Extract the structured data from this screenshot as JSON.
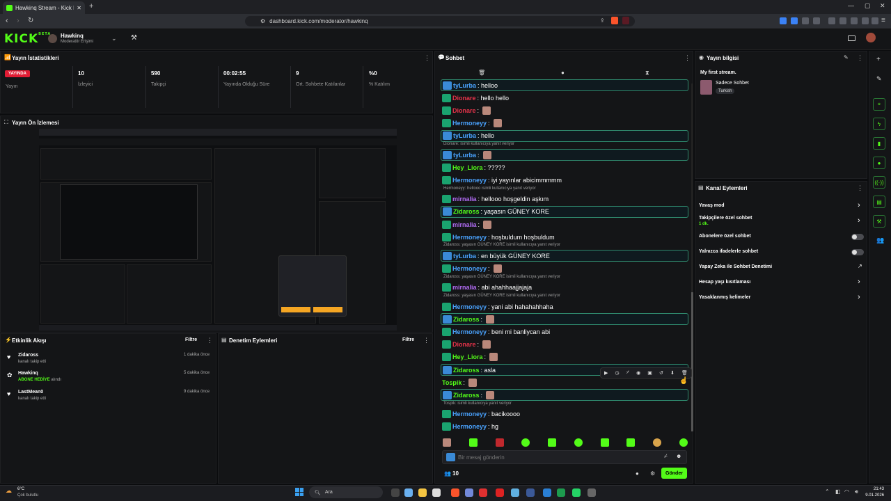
{
  "browser": {
    "tab_title": "Hawkinq Stream - Kick Dashb",
    "url": "dashboard.kick.com/moderator/hawkinq"
  },
  "header": {
    "logo": "KICK",
    "logo_tag": "BETA",
    "channel_name": "Hawkinq",
    "role": "Moderatör Erişimi"
  },
  "stats": {
    "title": "Yayın İstatistikleri",
    "live_badge": "YAYINDA",
    "live_label": "Yayın",
    "items": [
      {
        "value": "10",
        "label": "İzleyici"
      },
      {
        "value": "590",
        "label": "Takipçi"
      },
      {
        "value": "00:02:55",
        "label": "Yayında Olduğu Süre"
      },
      {
        "value": "9",
        "label": "Ort. Sohbete Katılanlar"
      },
      {
        "value": "%0",
        "label": "% Katılım"
      }
    ]
  },
  "preview": {
    "title": "Yayın Ön İzlemesi"
  },
  "activity": {
    "title": "Etkinlik Akışı",
    "filter": "Filtre",
    "items": [
      {
        "name": "Zidaross",
        "desc": "kanalı takip etti",
        "highlight": "",
        "time": "1 dakika önce"
      },
      {
        "name": "Hawkinq",
        "desc": "alındı",
        "highlight": "ABONE HEDİYE",
        "time": "5 dakika önce"
      },
      {
        "name": "LastMean0",
        "desc": "kanalı takip etti",
        "highlight": "",
        "time": "9 dakika önce"
      }
    ]
  },
  "moderation": {
    "title": "Denetim Eylemleri",
    "filter": "Filtre"
  },
  "chat": {
    "title": "Sohbet",
    "input_placeholder": "Bir mesaj gönderin",
    "viewer_count": "10",
    "send": "Gönder",
    "messages": [
      {
        "user": "tyLurba",
        "color": "#4aa3ff",
        "text": ": helloo",
        "hl": true,
        "badge": "b-blu",
        "emote": false,
        "reply": ""
      },
      {
        "user": "Dionare",
        "color": "#e8334a",
        "text": ": hello hello",
        "hl": false,
        "badge": "b-grn",
        "emote": false,
        "reply": ""
      },
      {
        "user": "Dionare",
        "color": "#e8334a",
        "text": ":",
        "hl": false,
        "badge": "b-grn",
        "emote": true,
        "reply": ""
      },
      {
        "user": "Hermoneyy",
        "color": "#4aa3ff",
        "text": ":",
        "hl": false,
        "badge": "b-grn",
        "emote": true,
        "reply": ""
      },
      {
        "user": "tyLurba",
        "color": "#4aa3ff",
        "text": ": hello",
        "hl": true,
        "badge": "b-blu",
        "emote": false,
        "reply": ""
      },
      {
        "user": "tyLurba",
        "color": "#4aa3ff",
        "text": ":",
        "hl": true,
        "badge": "b-blu",
        "emote": true,
        "reply": "Dionare: isimli kullanıcıya yanıt veriyor"
      },
      {
        "user": "Hey_Liora",
        "color": "#53fc18",
        "text": ": ?????",
        "hl": false,
        "badge": "b-grn",
        "emote": false,
        "reply": ""
      },
      {
        "user": "Hermoneyy",
        "color": "#4aa3ff",
        "text": ": iyi yayınlar abicimmmmm",
        "hl": false,
        "badge": "b-grn",
        "emote": false,
        "reply": ""
      },
      {
        "user": "mirnalia",
        "color": "#b26cf5",
        "text": ": hellooo hoşgeldin aşkım",
        "hl": false,
        "badge": "b-grn",
        "emote": false,
        "reply": "Hermoneyy: hellooo isimli kullanıcıya yanıt veriyor"
      },
      {
        "user": "Zidaross",
        "color": "#53fc18",
        "text": ": yaşasın GÜNEY KORE",
        "hl": true,
        "badge": "b-blu",
        "emote": false,
        "reply": ""
      },
      {
        "user": "mirnalia",
        "color": "#b26cf5",
        "text": ":",
        "hl": false,
        "badge": "b-grn",
        "emote": true,
        "reply": ""
      },
      {
        "user": "Hermoneyy",
        "color": "#4aa3ff",
        "text": ": hoşbuldum hoşbuldum",
        "hl": false,
        "badge": "b-grn",
        "emote": false,
        "reply": ""
      },
      {
        "user": "tyLurba",
        "color": "#4aa3ff",
        "text": ": en büyük GÜNEY KORE",
        "hl": true,
        "badge": "b-blu",
        "emote": false,
        "reply": "Zidaross: yaşasın GÜNEY KORE isimli kullanıcıya yanıt veriyor"
      },
      {
        "user": "Hermoneyy",
        "color": "#4aa3ff",
        "text": ":",
        "hl": false,
        "badge": "b-grn",
        "emote": true,
        "reply": ""
      },
      {
        "user": "mirnalia",
        "color": "#b26cf5",
        "text": ": abi ahahhaajjajaja",
        "hl": false,
        "badge": "b-grn",
        "emote": false,
        "reply": "Zidaross: yaşasın GÜNEY KORE isimli kullanıcıya yanıt veriyor"
      },
      {
        "user": "Hermoneyy",
        "color": "#4aa3ff",
        "text": ": yani abi hahahahhaha",
        "hl": false,
        "badge": "b-grn",
        "emote": false,
        "reply": "Zidaross: yaşasın GÜNEY KORE isimli kullanıcıya yanıt veriyor"
      },
      {
        "user": "Zidaross",
        "color": "#53fc18",
        "text": ":",
        "hl": true,
        "badge": "b-blu",
        "emote": true,
        "reply": ""
      },
      {
        "user": "Hermoneyy",
        "color": "#4aa3ff",
        "text": ": beni mi banliycan abi",
        "hl": false,
        "badge": "b-grn",
        "emote": false,
        "reply": ""
      },
      {
        "user": "Dionare",
        "color": "#e8334a",
        "text": ":",
        "hl": false,
        "badge": "b-grn",
        "emote": true,
        "reply": ""
      },
      {
        "user": "Hey_Liora",
        "color": "#53fc18",
        "text": ":",
        "hl": false,
        "badge": "b-grn",
        "emote": true,
        "reply": ""
      },
      {
        "user": "Zidaross",
        "color": "#53fc18",
        "text": ": asla",
        "hl": true,
        "badge": "b-blu",
        "emote": false,
        "reply": ""
      },
      {
        "user": "Tospik",
        "color": "#53fc18",
        "text": ":",
        "hl": false,
        "badge": "",
        "emote": true,
        "reply": ""
      },
      {
        "user": "Zidaross",
        "color": "#53fc18",
        "text": ":",
        "hl": true,
        "badge": "b-blu",
        "emote": true,
        "reply": ""
      },
      {
        "user": "Hermoneyy",
        "color": "#4aa3ff",
        "text": ": bacikoooo",
        "hl": false,
        "badge": "b-grn",
        "emote": false,
        "reply": "Tospik: isimli kullanıcıya yanıt veriyor"
      },
      {
        "user": "Hermoneyy",
        "color": "#4aa3ff",
        "text": ": hg",
        "hl": false,
        "badge": "b-grn",
        "emote": false,
        "reply": ""
      }
    ]
  },
  "stream_info": {
    "title": "Yayın bilgisi",
    "stream_title": "My first stream.",
    "category": "Sadece Sohbet",
    "tag": "Turkish"
  },
  "channel_actions": {
    "title": "Kanal Eylemleri",
    "items": [
      {
        "label": "Yavaş mod",
        "sub": "",
        "control": "arrow"
      },
      {
        "label": "Takipçilere özel sohbet",
        "sub": "1 dk.",
        "control": "arrow"
      },
      {
        "label": "Abonelere özel sohbet",
        "sub": "",
        "control": "toggle"
      },
      {
        "label": "Yalnızca ifadelerle sohbet",
        "sub": "",
        "control": "toggle"
      },
      {
        "label": "Yapay Zeka ile Sohbet Denetimi",
        "sub": "",
        "control": "link"
      },
      {
        "label": "Hesap yaşı kısıtlaması",
        "sub": "",
        "control": "arrow"
      },
      {
        "label": "Yasaklanmış kelimeler",
        "sub": "",
        "control": "arrow"
      }
    ]
  },
  "taskbar": {
    "weather_temp": "6°C",
    "weather_desc": "Çok bulutlu",
    "search": "Ara",
    "time": "21:43",
    "date": "9.01.2026"
  }
}
